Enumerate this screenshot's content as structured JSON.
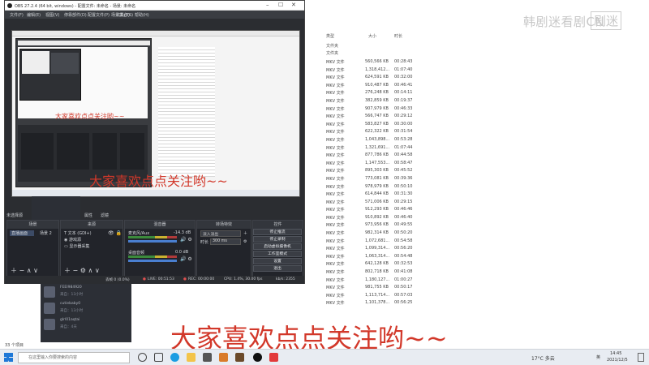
{
  "explorer": {
    "col_type": "类型",
    "col_size": "大小",
    "col_dur": "时长",
    "folder_label_1": "文件夹",
    "folder_label_2": "文件夹",
    "rows": [
      {
        "type": "MKV 文件",
        "size": "560,566 KB",
        "dur": "00:28:43"
      },
      {
        "type": "MKV 文件",
        "size": "1,318,412...",
        "dur": "01:07:40"
      },
      {
        "type": "MKV 文件",
        "size": "624,591 KB",
        "dur": "00:32:00"
      },
      {
        "type": "MKV 文件",
        "size": "910,487 KB",
        "dur": "00:46:41"
      },
      {
        "type": "MKV 文件",
        "size": "276,248 KB",
        "dur": "00:14:11"
      },
      {
        "type": "MKV 文件",
        "size": "382,859 KB",
        "dur": "00:19:37"
      },
      {
        "type": "MKV 文件",
        "size": "907,979 KB",
        "dur": "00:46:33"
      },
      {
        "type": "MKV 文件",
        "size": "566,747 KB",
        "dur": "00:29:12"
      },
      {
        "type": "MKV 文件",
        "size": "583,827 KB",
        "dur": "00:30:00"
      },
      {
        "type": "MKV 文件",
        "size": "622,322 KB",
        "dur": "00:31:54"
      },
      {
        "type": "MKV 文件",
        "size": "1,043,898...",
        "dur": "00:53:28"
      },
      {
        "type": "MKV 文件",
        "size": "1,321,691...",
        "dur": "01:07:44"
      },
      {
        "type": "MKV 文件",
        "size": "877,786 KB",
        "dur": "00:44:58"
      },
      {
        "type": "MKV 文件",
        "size": "1,147,553...",
        "dur": "00:58:47"
      },
      {
        "type": "MKV 文件",
        "size": "895,303 KB",
        "dur": "00:45:52"
      },
      {
        "type": "MKV 文件",
        "size": "773,081 KB",
        "dur": "00:39:36"
      },
      {
        "type": "MKV 文件",
        "size": "978,979 KB",
        "dur": "00:50:10"
      },
      {
        "type": "MKV 文件",
        "size": "614,844 KB",
        "dur": "00:31:30"
      },
      {
        "type": "MKV 文件",
        "size": "571,006 KB",
        "dur": "00:29:15"
      },
      {
        "type": "MKV 文件",
        "size": "912,293 KB",
        "dur": "00:46:46"
      },
      {
        "type": "MKV 文件",
        "size": "910,892 KB",
        "dur": "00:46:40"
      },
      {
        "type": "MKV 文件",
        "size": "973,956 KB",
        "dur": "00:49:55"
      },
      {
        "type": "MKV 文件",
        "size": "982,314 KB",
        "dur": "00:50:20"
      },
      {
        "type": "MKV 文件",
        "size": "1,072,681...",
        "dur": "00:54:58"
      },
      {
        "type": "MKV 文件",
        "size": "1,099,314...",
        "dur": "00:56:20"
      },
      {
        "type": "MKV 文件",
        "size": "1,063,314...",
        "dur": "00:54:48"
      },
      {
        "type": "MKV 文件",
        "size": "642,128 KB",
        "dur": "00:32:53"
      },
      {
        "type": "MKV 文件",
        "size": "802,718 KB",
        "dur": "00:41:08"
      },
      {
        "type": "MKV 文件",
        "size": "1,180,127...",
        "dur": "01:00:27"
      },
      {
        "type": "MKV 文件",
        "size": "981,755 KB",
        "dur": "00:50:17"
      },
      {
        "type": "MKV 文件",
        "size": "1,113,714...",
        "dur": "00:57:03"
      },
      {
        "type": "MKV 文件",
        "size": "1,101,378...",
        "dur": "00:56:25"
      }
    ],
    "item_count": "33 个项目"
  },
  "watermark": {
    "text": "韩剧迷看剧CN",
    "badge": "剧迷"
  },
  "chat": {
    "items": [
      {
        "name": "FEEI984920",
        "msg": "来自：13小时"
      },
      {
        "name": "cutiebaby0",
        "msg": "来自：13小时"
      },
      {
        "name": "gIrl01aqtai",
        "msg": "来自：13小时"
      }
    ],
    "msg3": "来自：4天"
  },
  "obs": {
    "title": "OBS 27.2.4 (64 bit, windows) - 配置文件: 未命名 - 场景: 未命名",
    "menu": [
      "文件(F)",
      "编辑(E)",
      "视图(V)",
      "停靠部件(D)",
      "配置文件(P)",
      "场景集合(S)",
      "工具(T)",
      "帮助(H)"
    ],
    "source_label": "未选择源",
    "props_label": "属性",
    "filter_label": "滤镜",
    "panels": {
      "scenes": "场景",
      "sources": "来源",
      "mixer": "混音器",
      "transitions": "转场特效",
      "controls": "控件"
    },
    "scenes": [
      "直播画面",
      "场景 2"
    ],
    "sources": [
      "文本 (GDI+)",
      "游戏源",
      "显示器采集"
    ],
    "mixer": [
      {
        "name": "麦克风/Aux",
        "db": "-14.3 dB"
      },
      {
        "name": "桌面音频",
        "db": "0.0 dB"
      }
    ],
    "transition": {
      "type": "淡入淡出",
      "duration_label": "时长",
      "duration": "300 ms"
    },
    "controls": [
      "停止推流",
      "停止录制",
      "启动虚拟摄像机",
      "工作室模式",
      "设置",
      "退出"
    ],
    "status": {
      "dropped": "丢帧 0 (0.0%)",
      "live": "LIVE: 00:51:53",
      "rec": "REC: 00:00:00",
      "cpu": "CPU: 1.4%, 30.00 fps",
      "kbps": "kb/s: 2355"
    }
  },
  "captions": {
    "big": "大家喜欢点点关注哟~~",
    "medium": "大家喜欢点点关注哟~~",
    "small": "大家喜欢点点关注哟~~"
  },
  "taskbar": {
    "search_placeholder": "在这里输入你要搜索的内容",
    "weather": "17°C 多云",
    "lang": "英",
    "time": "14:45",
    "date": "2021/12/5"
  }
}
